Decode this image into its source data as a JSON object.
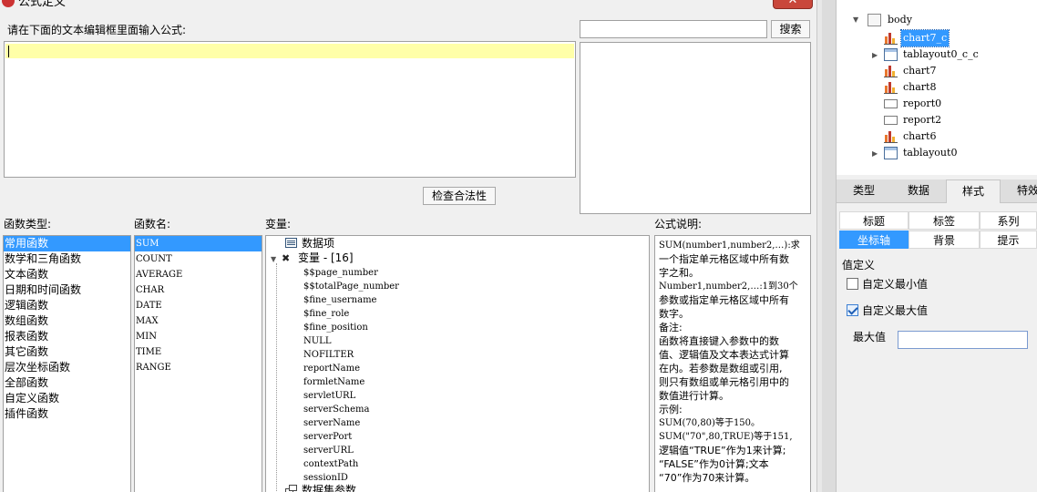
{
  "dialog": {
    "title": "公式定义",
    "close_label": "✕",
    "prompt_label": "请在下面的文本编辑框里面输入公式:",
    "formula_value": "",
    "search_value": "",
    "search_button": "搜索",
    "check_button": "检查合法性"
  },
  "function_types": {
    "label": "函数类型:",
    "items": [
      "常用函数",
      "数学和三角函数",
      "文本函数",
      "日期和时间函数",
      "逻辑函数",
      "数组函数",
      "报表函数",
      "其它函数",
      "层次坐标函数",
      "全部函数",
      "自定义函数",
      "插件函数"
    ],
    "selected": "常用函数"
  },
  "function_names": {
    "label": "函数名:",
    "items": [
      "SUM",
      "COUNT",
      "AVERAGE",
      "CHAR",
      "DATE",
      "MAX",
      "MIN",
      "TIME",
      "RANGE"
    ],
    "selected": "SUM"
  },
  "variables": {
    "label": "变量:",
    "data_items": "数据项",
    "variables_node": "变量 - [16]",
    "entries": [
      "$$page_number",
      "$$totalPage_number",
      "$fine_username",
      "$fine_role",
      "$fine_position",
      "NULL",
      "NOFILTER",
      "reportName",
      "formletName",
      "servletURL",
      "serverSchema",
      "serverName",
      "serverPort",
      "serverURL",
      "contextPath",
      "sessionID"
    ],
    "dataset_params": "数据集参数"
  },
  "description": {
    "label": "公式说明:",
    "lines": [
      "SUM(number1,number2,…):求",
      "一个指定单元格区域中所有数",
      "字之和。",
      "Number1,number2,…:1到30个",
      "参数或指定单元格区域中所有",
      "数字。",
      "备注:",
      "函数将直接键入参数中的数",
      "值、逻辑值及文本表达式计算",
      "在内。若参数是数组或引用,",
      "则只有数组或单元格引用中的",
      "数值进行计算。",
      "示例:",
      "SUM(70,80)等于150。",
      "SUM(\"70\",80,TRUE)等于151,",
      "逻辑值“TRUE”作为1来计算;",
      "“FALSE”作为0计算;文本",
      "“70”作为70来计算。"
    ]
  },
  "widget_tree": {
    "body": "body",
    "nodes": [
      {
        "label": "chart7_c",
        "icon": "chart-icon",
        "selected": true
      },
      {
        "label": "tablayout0_c_c",
        "icon": "tab-layout-icon",
        "expandable": true
      },
      {
        "label": "chart7",
        "icon": "chart-icon"
      },
      {
        "label": "chart8",
        "icon": "chart-icon"
      },
      {
        "label": "report0",
        "icon": "report-icon"
      },
      {
        "label": "report2",
        "icon": "report-icon"
      },
      {
        "label": "chart6",
        "icon": "chart-icon"
      },
      {
        "label": "tablayout0",
        "icon": "tab-layout-icon",
        "expandable": true
      }
    ]
  },
  "properties": {
    "tabs": [
      "类型",
      "数据",
      "样式",
      "特效"
    ],
    "active_tab": "样式",
    "subtabs_row1": [
      "标题",
      "标签",
      "系列"
    ],
    "subtabs_row2": [
      "坐标轴",
      "背景",
      "提示"
    ],
    "active_subtab": "坐标轴",
    "custom_label": "值定义",
    "custom_min_label": "自定义最小值",
    "custom_min_checked": false,
    "custom_max_label": "自定义最大值",
    "custom_max_checked": true,
    "max_value_label": "最大值",
    "max_value": ""
  },
  "colors": {
    "selection": "#3399ff",
    "formula_highlight": "#ffffa8",
    "chart_icon_orange": "#e8772e"
  }
}
